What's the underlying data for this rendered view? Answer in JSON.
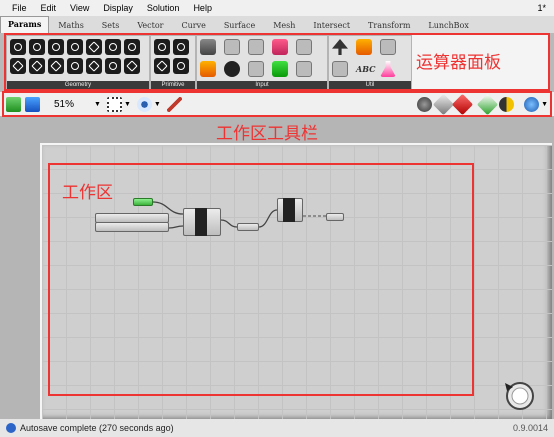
{
  "menu": {
    "items": [
      "File",
      "Edit",
      "View",
      "Display",
      "Solution",
      "Help"
    ],
    "version_marker": "1*"
  },
  "tabs": [
    "Params",
    "Maths",
    "Sets",
    "Vector",
    "Curve",
    "Surface",
    "Mesh",
    "Intersect",
    "Transform",
    "LunchBox"
  ],
  "panel_groups": [
    {
      "name": "Geometry"
    },
    {
      "name": "Primitive"
    },
    {
      "name": "Input"
    },
    {
      "name": "Util"
    }
  ],
  "annotations": {
    "panel_label": "运算器面板",
    "toolbar_label": "工作区工具栏",
    "workspace_label": "工作区"
  },
  "toolbar": {
    "zoom": "51%"
  },
  "status": {
    "message": "Autosave complete (270 seconds ago)",
    "version": "0.9.0014"
  },
  "colors": {
    "annotation": "#e33333",
    "status_icon": "#2c64c8"
  }
}
